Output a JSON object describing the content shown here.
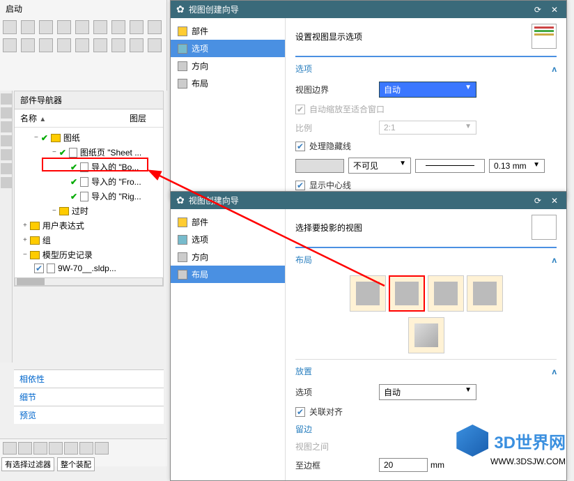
{
  "top": {
    "start_label": "启动"
  },
  "navigator": {
    "title": "部件导航器",
    "col_name": "名称",
    "col_layer": "图层",
    "tree": {
      "root": "图纸",
      "sheet": "图纸页 \"Sheet ...",
      "imp_bo": "导入的 \"Bo...",
      "imp_fro": "导入的 \"Fro...",
      "imp_rig": "导入的 \"Rig...",
      "obsolete": "过时",
      "user_expr": "用户表达式",
      "group": "组",
      "history": "模型历史记录",
      "sldp": "9W-70__.sldp..."
    }
  },
  "tabs": {
    "dep": "相依性",
    "detail": "细节",
    "preview": "预览"
  },
  "filter": {
    "label": "有选择过滤器",
    "whole": "整个装配"
  },
  "wizard1": {
    "title": "视图创建向导",
    "nav": {
      "part": "部件",
      "option": "选项",
      "orient": "方向",
      "layout": "布局"
    },
    "desc": "设置视图显示选项",
    "section_options": "选项",
    "view_boundary": "视图边界",
    "vb_value": "自动",
    "auto_scale": "自动缩放至适合窗口",
    "ratio": "比例",
    "ratio_value": "2:1",
    "hidden_line": "处理隐藏线",
    "invisible": "不可见",
    "line_weight": "0.13 mm",
    "show_center": "显示中心线"
  },
  "wizard2": {
    "title": "视图创建向导",
    "nav": {
      "part": "部件",
      "option": "选项",
      "orient": "方向",
      "layout": "布局"
    },
    "desc": "选择要投影的视图",
    "section_layout": "布局",
    "section_place": "放置",
    "option": "选项",
    "option_value": "自动",
    "relate_align": "关联对齐",
    "margin": "留边",
    "between_views": "视图之间",
    "to_border": "至边框",
    "to_border_value": "20",
    "to_border_unit": "mm"
  },
  "watermark": {
    "brand": "3D世界网",
    "url": "WWW.3DSJW.COM"
  }
}
